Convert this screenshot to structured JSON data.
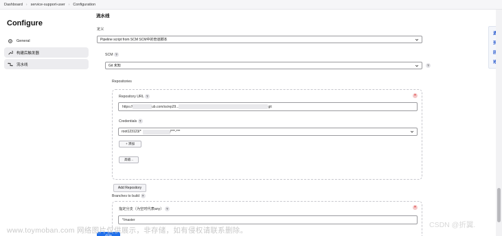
{
  "breadcrumb": [
    "Dashboard",
    "service-support-user",
    "Configuration"
  ],
  "sidebar": {
    "title": "Configure",
    "items": [
      {
        "label": "General",
        "icon": "gear-icon"
      },
      {
        "label": "构建后触发器",
        "icon": "wrench-icon"
      },
      {
        "label": "流水线",
        "icon": "pipeline-icon"
      }
    ]
  },
  "pipeline": {
    "section_title": "流水线",
    "definition_label": "定义",
    "definition_value": "Pipeline script from SCM SCM中的管道脚本",
    "scm_label": "SCM",
    "scm_value": "Git 未知",
    "repositories_label": "Repositories",
    "repo_url_label": "Repository URL",
    "repo_url_prefix": "https://",
    "repo_url_mid": "ub.com/ss/ep29...",
    "repo_url_suffix": "git",
    "credentials_label": "Credentials",
    "credentials_value": "root123123/*",
    "credentials_suffix": "/***-***",
    "add_button": "+ 添加",
    "advanced_button": "高级...",
    "add_repository": "Add Repository",
    "branches_label": "Branches to build",
    "branch_specifier_label": "指定分支（为空时代表any）",
    "branch_value": "*/master",
    "save_button": "保存"
  },
  "floating_panel": [
    "遇",
    "到",
    "困",
    "难"
  ],
  "watermarks": {
    "left": "www.toymoban.com 网络图片仅供展示，非存储，如有侵权请联系删除。",
    "right": "CSDN @折翼."
  }
}
